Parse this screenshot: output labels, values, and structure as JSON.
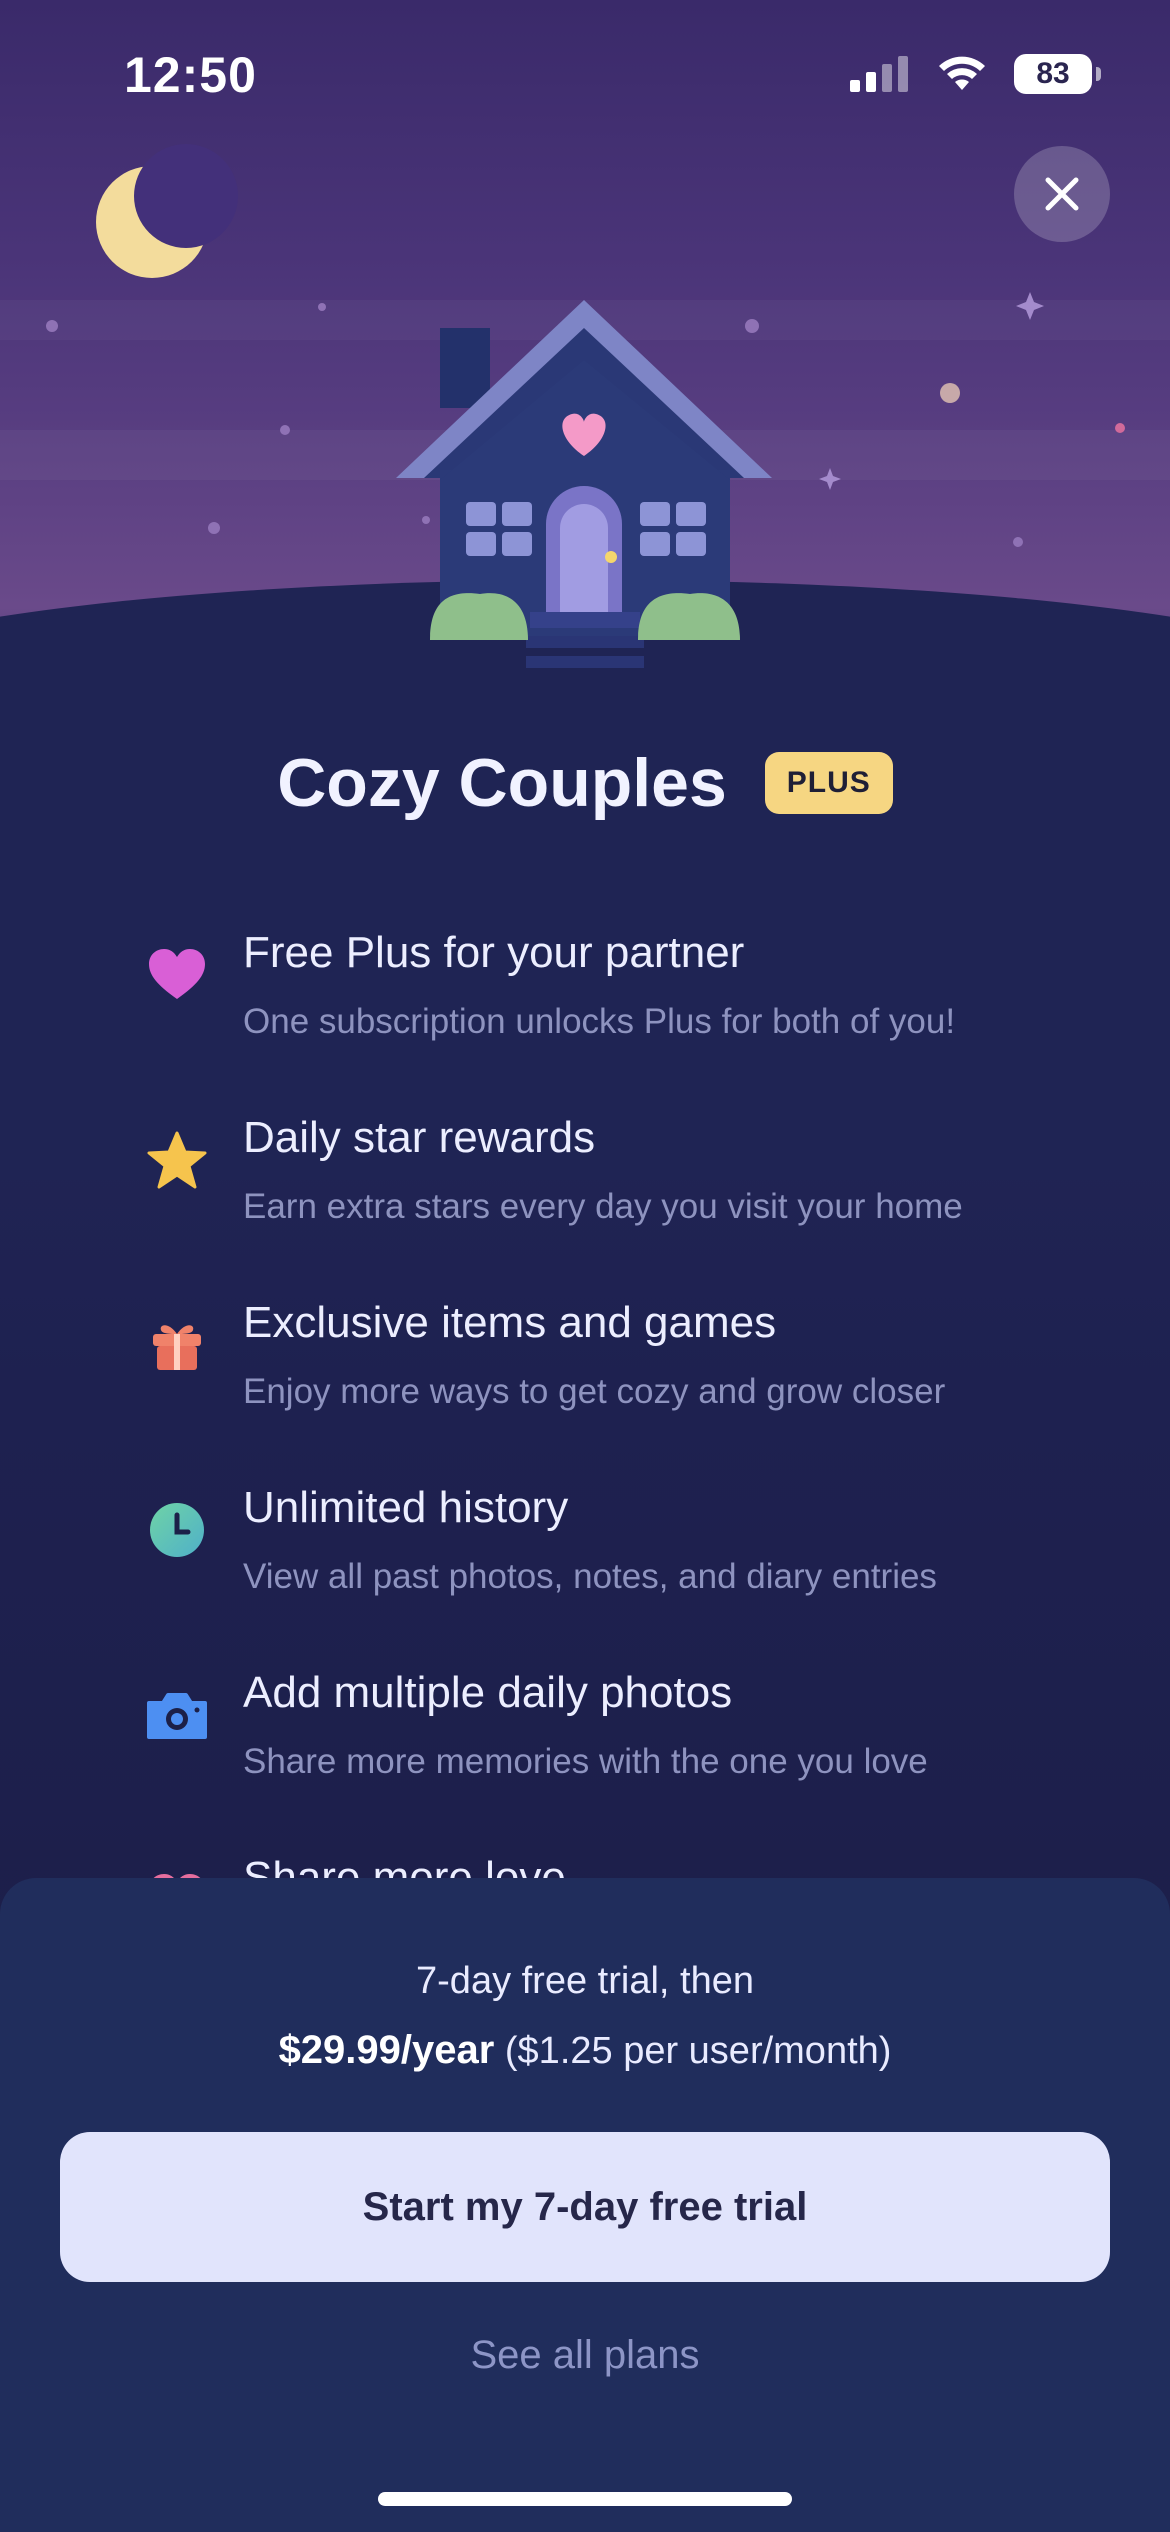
{
  "status_bar": {
    "time": "12:50",
    "battery": "83"
  },
  "colors": {
    "accent_badge": "#f6d682",
    "cta_bg": "#e1e4fc",
    "sheet_bg": "#202d5c"
  },
  "header": {
    "title": "Cozy Couples",
    "badge": "PLUS"
  },
  "features": [
    {
      "icon": "heart-icon",
      "title": "Free Plus for your partner",
      "subtitle": "One subscription unlocks Plus for both of you!"
    },
    {
      "icon": "star-icon",
      "title": "Daily star rewards",
      "subtitle": "Earn extra stars every day you visit your home"
    },
    {
      "icon": "gift-icon",
      "title": "Exclusive items and games",
      "subtitle": "Enjoy more ways to get cozy and grow closer"
    },
    {
      "icon": "clock-icon",
      "title": "Unlimited history",
      "subtitle": "View all past photos, notes, and diary entries"
    },
    {
      "icon": "camera-icon",
      "title": "Add multiple daily photos",
      "subtitle": "Share more memories with the one you love"
    },
    {
      "icon": "heart-icon",
      "title": "Share more love",
      "subtitle": ""
    }
  ],
  "offer": {
    "trial_text": "7-day free trial, then",
    "price": "$29.99/year",
    "price_detail": "($1.25 per user/month)"
  },
  "cta_label": "Start my 7-day free trial",
  "secondary_label": "See all plans"
}
